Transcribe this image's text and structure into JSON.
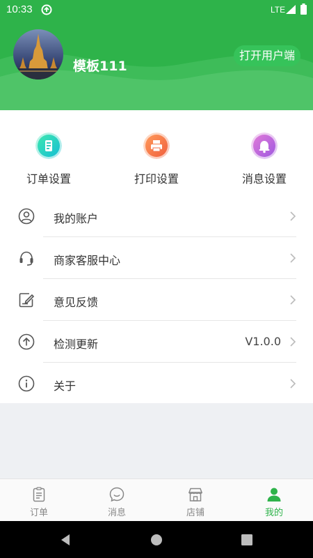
{
  "status_bar": {
    "time": "10:33",
    "network": "LTE"
  },
  "header": {
    "username": "模板111",
    "open_user_button": "打开用户端",
    "brand_color": "#2eb34a"
  },
  "quick_settings": [
    {
      "label": "订单设置",
      "icon": "order-settings-icon",
      "color": "#1fd0a8"
    },
    {
      "label": "打印设置",
      "icon": "printer-icon",
      "color": "#f5774a"
    },
    {
      "label": "消息设置",
      "icon": "bell-icon",
      "color": "#c060d8"
    }
  ],
  "menu": [
    {
      "label": "我的账户",
      "icon": "user-icon",
      "value": ""
    },
    {
      "label": "商家客服中心",
      "icon": "headset-icon",
      "value": ""
    },
    {
      "label": "意见反馈",
      "icon": "feedback-edit-icon",
      "value": ""
    },
    {
      "label": "检测更新",
      "icon": "upload-arrow-icon",
      "value": "V1.0.0"
    },
    {
      "label": "关于",
      "icon": "info-icon",
      "value": ""
    }
  ],
  "tabs": [
    {
      "label": "订单",
      "icon": "orders-clipboard-icon",
      "active": false
    },
    {
      "label": "消息",
      "icon": "message-smile-icon",
      "active": false
    },
    {
      "label": "店铺",
      "icon": "store-icon",
      "active": false
    },
    {
      "label": "我的",
      "icon": "profile-icon",
      "active": true
    }
  ]
}
